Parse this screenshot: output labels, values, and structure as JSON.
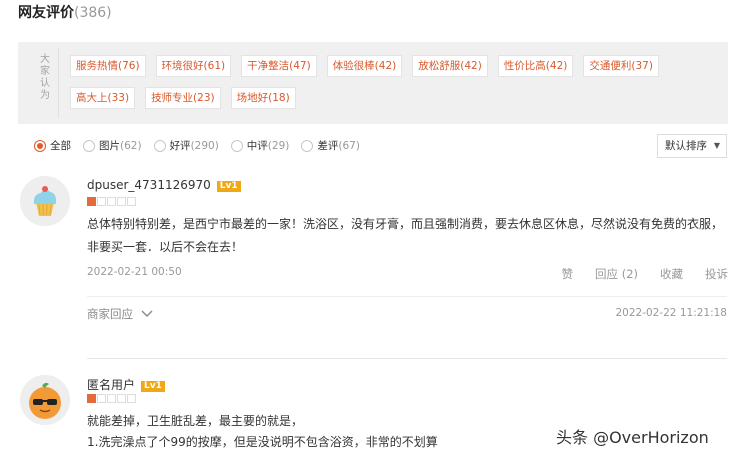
{
  "header": {
    "title": "网友评价",
    "count": "(386)"
  },
  "tag_panel": {
    "side_label": [
      "大",
      "家",
      "认",
      "为"
    ],
    "tags": [
      "服务热情(76)",
      "环境很好(61)",
      "干净整洁(47)",
      "体验很棒(42)",
      "放松舒服(42)",
      "性价比高(42)",
      "交通便利(37)",
      "高大上(33)",
      "技师专业(23)",
      "场地好(18)"
    ]
  },
  "filters": [
    {
      "label": "全部",
      "count": "",
      "selected": true
    },
    {
      "label": "图片",
      "count": "(62)",
      "selected": false
    },
    {
      "label": "好评",
      "count": "(290)",
      "selected": false
    },
    {
      "label": "中评",
      "count": "(29)",
      "selected": false
    },
    {
      "label": "差评",
      "count": "(67)",
      "selected": false
    }
  ],
  "sort": {
    "label": "默认排序",
    "icon": "chevron-down-icon"
  },
  "reviews": [
    {
      "username": "dpuser_4731126970",
      "level": "Lv1",
      "rating": 1,
      "text": "总体特别特别差，是西宁市最差的一家！洗浴区，没有牙膏，而且强制消费，要去休息区休息，尽然说没有免费的衣服，非要买一套．以后不会在去！",
      "date": "2022-02-21 00:50",
      "actions": {
        "like": "赞",
        "reply": "回应 (2)",
        "favorite": "收藏",
        "report": "投诉"
      },
      "merchant_reply": {
        "label": "商家回应",
        "date": "2022-02-22 11:21:18"
      }
    },
    {
      "username": "匿名用户",
      "level": "Lv1",
      "rating": 1,
      "lines": [
        "就能差掉，卫生脏乱差，最主要的就是，",
        "1.洗完澡点了个99的按摩，但是没说明不包含浴资，非常的不划算"
      ]
    }
  ],
  "watermark": "头条 @OverHorizon",
  "colors": {
    "accent": "#e05a2b",
    "tag_text": "#d9592c",
    "level_badge": "#f0a818"
  }
}
